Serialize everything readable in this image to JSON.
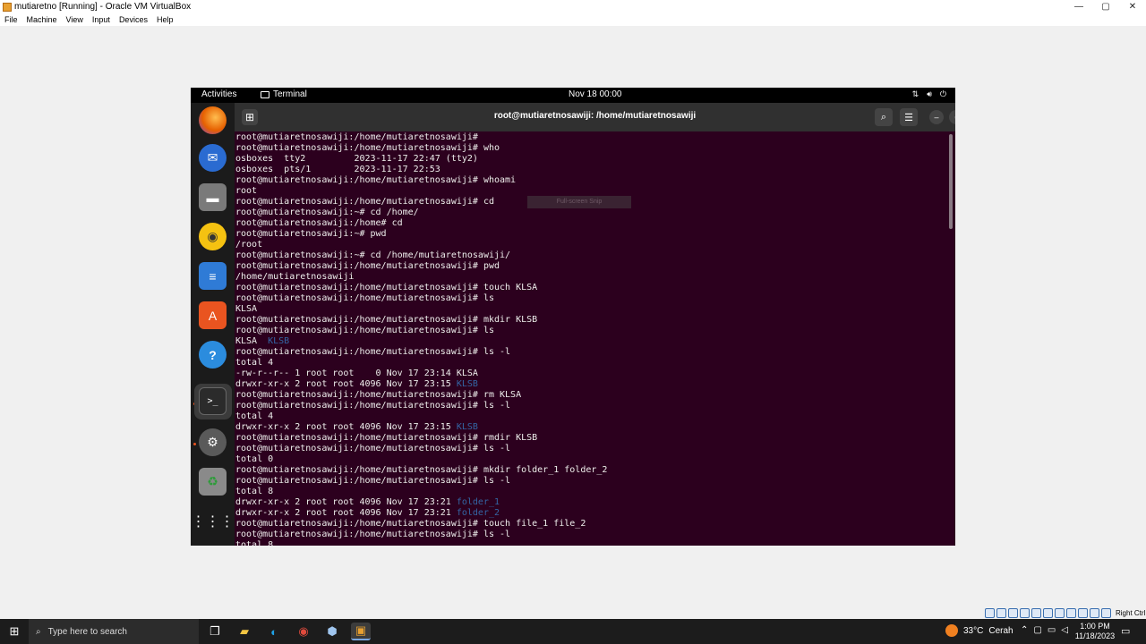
{
  "window": {
    "title": "mutiaretno [Running] - Oracle VM VirtualBox",
    "controls": [
      "—",
      "▢",
      "✕"
    ]
  },
  "vbox_menu": [
    "File",
    "Machine",
    "View",
    "Input",
    "Devices",
    "Help"
  ],
  "guest": {
    "topbar": {
      "activities": "Activities",
      "app": "Terminal",
      "clock": "Nov 18  00:00"
    },
    "terminal": {
      "title": "root@mutiaretnosawiji: /home/mutiaretnosawiji",
      "tooltip": "Full-screen Snip",
      "lines": [
        {
          "segments": [
            {
              "t": "root@mutiaretnosawiji:/home/mutiaretnosawiji#"
            }
          ]
        },
        {
          "segments": [
            {
              "t": "root@mutiaretnosawiji:/home/mutiaretnosawiji# who"
            }
          ]
        },
        {
          "segments": [
            {
              "t": "osboxes  tty2         2023-11-17 22:47 (tty2)"
            }
          ]
        },
        {
          "segments": [
            {
              "t": "osboxes  pts/1        2023-11-17 22:53"
            }
          ]
        },
        {
          "segments": [
            {
              "t": "root@mutiaretnosawiji:/home/mutiaretnosawiji# whoami"
            }
          ]
        },
        {
          "segments": [
            {
              "t": "root"
            }
          ]
        },
        {
          "segments": [
            {
              "t": "root@mutiaretnosawiji:/home/mutiaretnosawiji# cd"
            }
          ]
        },
        {
          "segments": [
            {
              "t": "root@mutiaretnosawiji:~# cd /home/"
            }
          ]
        },
        {
          "segments": [
            {
              "t": "root@mutiaretnosawiji:/home# cd"
            }
          ]
        },
        {
          "segments": [
            {
              "t": "root@mutiaretnosawiji:~# pwd"
            }
          ]
        },
        {
          "segments": [
            {
              "t": "/root"
            }
          ]
        },
        {
          "segments": [
            {
              "t": "root@mutiaretnosawiji:~# cd /home/mutiaretnosawiji/"
            }
          ]
        },
        {
          "segments": [
            {
              "t": "root@mutiaretnosawiji:/home/mutiaretnosawiji# pwd"
            }
          ]
        },
        {
          "segments": [
            {
              "t": "/home/mutiaretnosawiji"
            }
          ]
        },
        {
          "segments": [
            {
              "t": "root@mutiaretnosawiji:/home/mutiaretnosawiji# touch KLSA"
            }
          ]
        },
        {
          "segments": [
            {
              "t": "root@mutiaretnosawiji:/home/mutiaretnosawiji# ls"
            }
          ]
        },
        {
          "segments": [
            {
              "t": "KLSA"
            }
          ]
        },
        {
          "segments": [
            {
              "t": "root@mutiaretnosawiji:/home/mutiaretnosawiji# mkdir KLSB"
            }
          ]
        },
        {
          "segments": [
            {
              "t": "root@mutiaretnosawiji:/home/mutiaretnosawiji# ls"
            }
          ]
        },
        {
          "segments": [
            {
              "t": "KLSA  "
            },
            {
              "t": "KLSB",
              "dir": true
            }
          ]
        },
        {
          "segments": [
            {
              "t": "root@mutiaretnosawiji:/home/mutiaretnosawiji# ls -l"
            }
          ]
        },
        {
          "segments": [
            {
              "t": "total 4"
            }
          ]
        },
        {
          "segments": [
            {
              "t": "-rw-r--r-- 1 root root    0 Nov 17 23:14 KLSA"
            }
          ]
        },
        {
          "segments": [
            {
              "t": "drwxr-xr-x 2 root root 4096 Nov 17 23:15 "
            },
            {
              "t": "KLSB",
              "dir": true
            }
          ]
        },
        {
          "segments": [
            {
              "t": "root@mutiaretnosawiji:/home/mutiaretnosawiji# rm KLSA"
            }
          ]
        },
        {
          "segments": [
            {
              "t": "root@mutiaretnosawiji:/home/mutiaretnosawiji# ls -l"
            }
          ]
        },
        {
          "segments": [
            {
              "t": "total 4"
            }
          ]
        },
        {
          "segments": [
            {
              "t": "drwxr-xr-x 2 root root 4096 Nov 17 23:15 "
            },
            {
              "t": "KLSB",
              "dir": true
            }
          ]
        },
        {
          "segments": [
            {
              "t": "root@mutiaretnosawiji:/home/mutiaretnosawiji# rmdir KLSB"
            }
          ]
        },
        {
          "segments": [
            {
              "t": "root@mutiaretnosawiji:/home/mutiaretnosawiji# ls -l"
            }
          ]
        },
        {
          "segments": [
            {
              "t": "total 0"
            }
          ]
        },
        {
          "segments": [
            {
              "t": "root@mutiaretnosawiji:/home/mutiaretnosawiji# mkdir folder_1 folder_2"
            }
          ]
        },
        {
          "segments": [
            {
              "t": "root@mutiaretnosawiji:/home/mutiaretnosawiji# ls -l"
            }
          ]
        },
        {
          "segments": [
            {
              "t": "total 8"
            }
          ]
        },
        {
          "segments": [
            {
              "t": "drwxr-xr-x 2 root root 4096 Nov 17 23:21 "
            },
            {
              "t": "folder_1",
              "dir": true
            }
          ]
        },
        {
          "segments": [
            {
              "t": "drwxr-xr-x 2 root root 4096 Nov 17 23:21 "
            },
            {
              "t": "folder_2",
              "dir": true
            }
          ]
        },
        {
          "segments": [
            {
              "t": "root@mutiaretnosawiji:/home/mutiaretnosawiji# touch file_1 file_2"
            }
          ]
        },
        {
          "segments": [
            {
              "t": "root@mutiaretnosawiji:/home/mutiaretnosawiji# ls -l"
            }
          ]
        },
        {
          "segments": [
            {
              "t": "total 8"
            }
          ]
        }
      ]
    }
  },
  "vbox_status": {
    "host_key": "Right Ctrl"
  },
  "taskbar": {
    "search_placeholder": "Type here to search",
    "weather_temp": "33°C",
    "weather_desc": "Cerah",
    "time": "1:00 PM",
    "date": "11/18/2023"
  },
  "colors": {
    "terminal_bg": "#2c001e",
    "directory": "#3465a4",
    "ubuntu_orange": "#e95420"
  }
}
